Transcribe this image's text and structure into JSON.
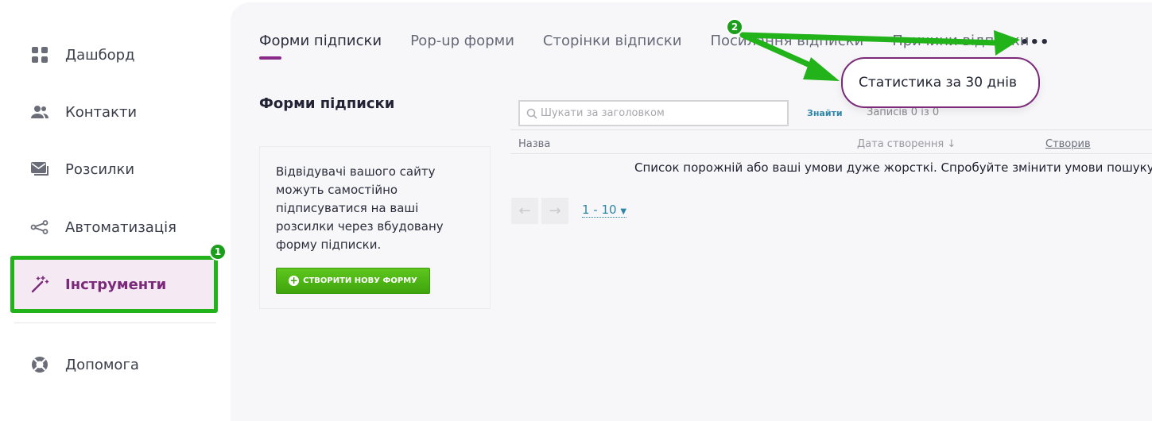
{
  "sidebar": {
    "items": [
      {
        "label": "Дашборд",
        "icon": "dashboard-grid-icon"
      },
      {
        "label": "Контакти",
        "icon": "contacts-icon"
      },
      {
        "label": "Розсилки",
        "icon": "mail-icon"
      },
      {
        "label": "Автоматизація",
        "icon": "automation-icon"
      },
      {
        "label": "Інструменти",
        "icon": "magic-wand-icon",
        "active": true
      },
      {
        "label": "Допомога",
        "icon": "help-lifebuoy-icon"
      }
    ]
  },
  "badges": {
    "step1": "1",
    "step2": "2"
  },
  "tabs": [
    {
      "label": "Форми підписки",
      "active": true
    },
    {
      "label": "Pop-up форми"
    },
    {
      "label": "Сторінки відписки"
    },
    {
      "label": "Посилання відписки"
    },
    {
      "label": "Причини відписки"
    }
  ],
  "more_menu": {
    "label": "•••"
  },
  "tooltip": {
    "label": "Статистика за 30 днів"
  },
  "section": {
    "title": "Форми підписки"
  },
  "info_card": {
    "text": "Відвідувачі вашого сайту можуть самостійно підписуватися на ваші розсилки через вбудовану форму підписки.",
    "button_label": "СТВОРИТИ НОВУ ФОРМУ"
  },
  "search": {
    "placeholder": "Шукати за заголовком",
    "value": ""
  },
  "find_label": "Знайти",
  "records_label": "Записів 0 із 0",
  "table": {
    "columns": [
      "Назва",
      "Дата створення ↓",
      "Створив"
    ],
    "empty_message": "Список порожній або ваші умови дуже жорсткі. Спробуйте змінити умови пошуку"
  },
  "pager": {
    "range": "1 - 10",
    "prev": "←",
    "next": "→"
  },
  "colors": {
    "accent": "#7a2a78",
    "annotation_green": "#22b31b",
    "link": "#2f86a8",
    "primary_button": "#4cb514"
  }
}
